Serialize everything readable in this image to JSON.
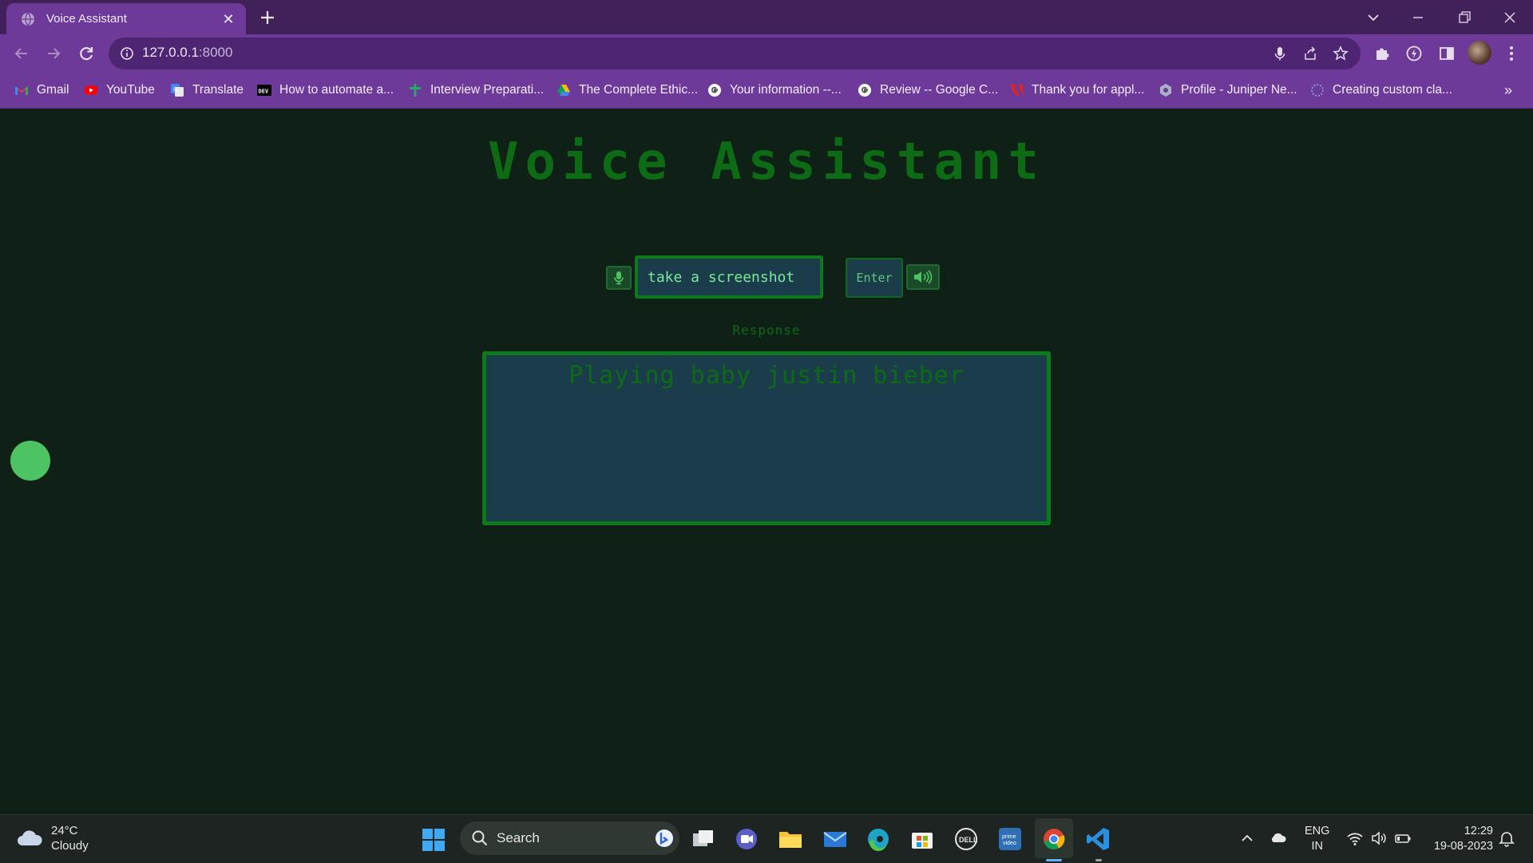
{
  "browser": {
    "tab_title": "Voice Assistant",
    "url_host": "127.0.0.1",
    "url_port": ":8000",
    "bookmarks": [
      {
        "label": "Gmail",
        "icon": "gmail-icon"
      },
      {
        "label": "YouTube",
        "icon": "youtube-icon"
      },
      {
        "label": "Translate",
        "icon": "translate-icon"
      },
      {
        "label": "How to automate a...",
        "icon": "dev-icon"
      },
      {
        "label": "Interview Preparati...",
        "icon": "plus-cross-icon"
      },
      {
        "label": "The Complete Ethic...",
        "icon": "drive-icon"
      },
      {
        "label": "Your information --...",
        "icon": "google-icon"
      },
      {
        "label": "Review -- Google C...",
        "icon": "google-icon"
      },
      {
        "label": "Thank you for appl...",
        "icon": "adobe-icon"
      },
      {
        "label": "Profile - Juniper Ne...",
        "icon": "juniper-icon"
      },
      {
        "label": "Creating custom cla...",
        "icon": "loading-icon"
      }
    ],
    "overflow_label": "»"
  },
  "app": {
    "heading": "Voice Assistant",
    "input_value": "take a screenshot",
    "enter_label": "Enter",
    "response_label": "Response",
    "response_text": "Playing baby justin bieber"
  },
  "taskbar": {
    "temperature": "24°C",
    "weather": "Cloudy",
    "search_label": "Search",
    "lang_top": "ENG",
    "lang_bottom": "IN",
    "time": "12:29",
    "date": "19-08-2023"
  },
  "colors": {
    "title_green": "#0c6b14",
    "input_text": "#7be89a",
    "panel_bg": "#1b3d4b",
    "page_bg": "#0f2016",
    "chrome_purple": "#6d3a9a"
  }
}
